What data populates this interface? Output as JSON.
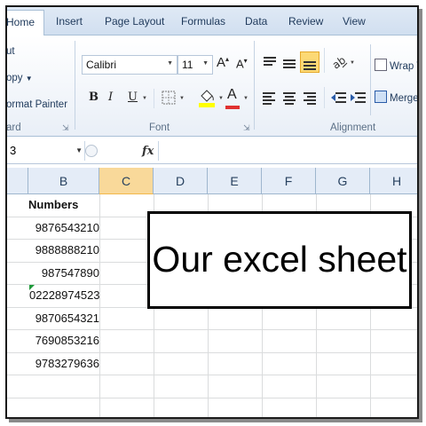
{
  "tabs": [
    "Home",
    "Insert",
    "Page Layout",
    "Formulas",
    "Data",
    "Review",
    "View"
  ],
  "clipboard": {
    "cut": "ut",
    "copy": "opy",
    "format_painter": "ormat Painter",
    "group_label": "ard"
  },
  "font": {
    "name": "Calibri",
    "size": "11",
    "grow": "A",
    "shrink": "A",
    "bold": "B",
    "italic": "I",
    "underline": "U",
    "font_color_letter": "A",
    "group_label": "Font"
  },
  "alignment": {
    "wrap_text": "Wrap Te",
    "merge": "Merge &",
    "group_label": "Alignment"
  },
  "formula_bar": {
    "name_box": "3",
    "fx": "fx"
  },
  "columns": [
    "B",
    "C",
    "D",
    "E",
    "F",
    "G",
    "H"
  ],
  "selected_column": "C",
  "sheet": {
    "header": "Numbers",
    "values": [
      "9876543210",
      "9888888210",
      "987547890",
      "02228974523",
      "9870654321",
      "7690853216",
      "9783279636"
    ]
  },
  "textbox": {
    "text": "Our excel sheet"
  },
  "colors": {
    "ribbon": "#dfe9f5",
    "selected_column": "#f9d99a",
    "error_indicator": "#1f9a3a",
    "highlight_yellow": "#ffff00",
    "font_red": "#e03030"
  }
}
